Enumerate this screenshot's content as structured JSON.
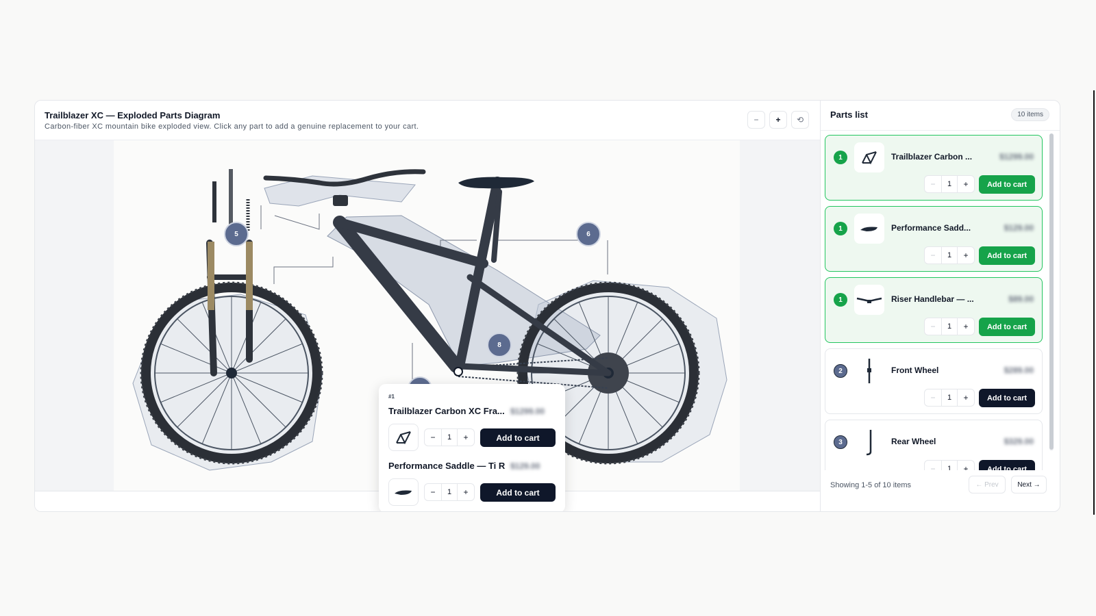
{
  "diagram": {
    "title": "Trailblazer XC — Exploded Parts Diagram",
    "subtitle": "Carbon-fiber XC mountain bike exploded view. Click any part to add a genuine replacement to your cart.",
    "zoom_out": "−",
    "zoom_in": "+",
    "zoom_reset": "⟲",
    "markers": [
      "5",
      "6",
      "8"
    ]
  },
  "popover": {
    "tag": "#1",
    "items": [
      {
        "name": "Trailblazer Carbon XC Fra...",
        "price": "$1299.00",
        "qty": "1",
        "button": "Add to cart",
        "icon": "frame-icon"
      },
      {
        "name": "Performance Saddle — Ti R...",
        "price": "$129.00",
        "qty": "1",
        "button": "Add to cart",
        "icon": "saddle-icon"
      }
    ]
  },
  "parts": {
    "title": "Parts list",
    "count": "10 items",
    "items": [
      {
        "badge": "1",
        "name": "Trailblazer Carbon ...",
        "price": "$1299.00",
        "qty": "1",
        "button": "Add to cart",
        "selected": true,
        "icon": "frame-icon"
      },
      {
        "badge": "1",
        "name": "Performance Sadd...",
        "price": "$129.00",
        "qty": "1",
        "button": "Add to cart",
        "selected": true,
        "icon": "saddle-icon"
      },
      {
        "badge": "1",
        "name": "Riser Handlebar — ...",
        "price": "$89.00",
        "qty": "1",
        "button": "Add to cart",
        "selected": true,
        "icon": "handlebar-icon"
      },
      {
        "badge": "2",
        "name": "Front Wheel",
        "price": "$289.00",
        "qty": "1",
        "button": "Add to cart",
        "selected": false,
        "icon": "fork-icon"
      },
      {
        "badge": "3",
        "name": "Rear Wheel",
        "price": "$329.00",
        "qty": "1",
        "button": "Add to cart",
        "selected": false,
        "icon": "seatpost-icon"
      }
    ],
    "footer": {
      "info": "Showing 1-5 of 10 items",
      "prev": "← Prev",
      "next": "Next →"
    }
  },
  "stepper": {
    "minus": "−",
    "plus": "+"
  },
  "colors": {
    "selected_green": "#16a34a",
    "dark_button": "#0f172a",
    "marker": "#5c6b8f"
  }
}
